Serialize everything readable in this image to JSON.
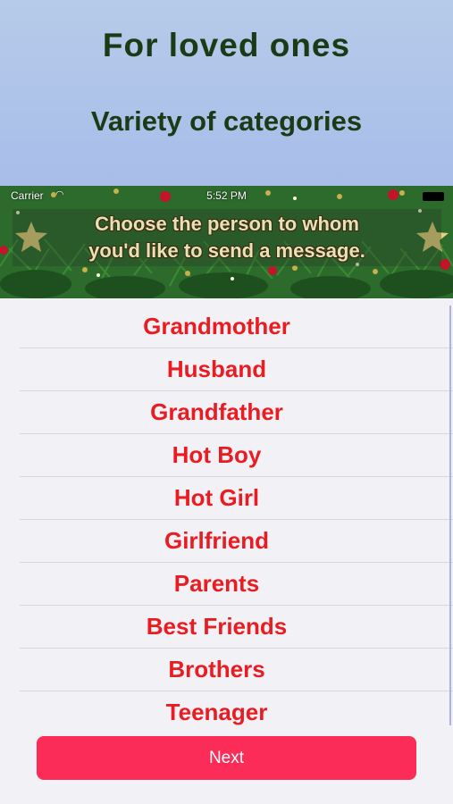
{
  "promo": {
    "title": "For loved ones",
    "subtitle": "Variety of categories"
  },
  "status_bar": {
    "carrier": "Carrier",
    "time": "5:52 PM"
  },
  "banner": {
    "line1": "Choose the person to whom",
    "line2": "you'd like to send a message."
  },
  "list": {
    "items": [
      {
        "label": "Grandmother"
      },
      {
        "label": "Husband"
      },
      {
        "label": "Grandfather"
      },
      {
        "label": "Hot Boy"
      },
      {
        "label": "Hot Girl"
      },
      {
        "label": "Girlfriend"
      },
      {
        "label": "Parents"
      },
      {
        "label": "Best Friends"
      },
      {
        "label": "Brothers"
      },
      {
        "label": "Teenager"
      }
    ]
  },
  "actions": {
    "next_label": "Next"
  },
  "colors": {
    "item_text": "#ea1c22",
    "button_bg": "#fb2c57",
    "promo_text": "#1b3a16"
  }
}
